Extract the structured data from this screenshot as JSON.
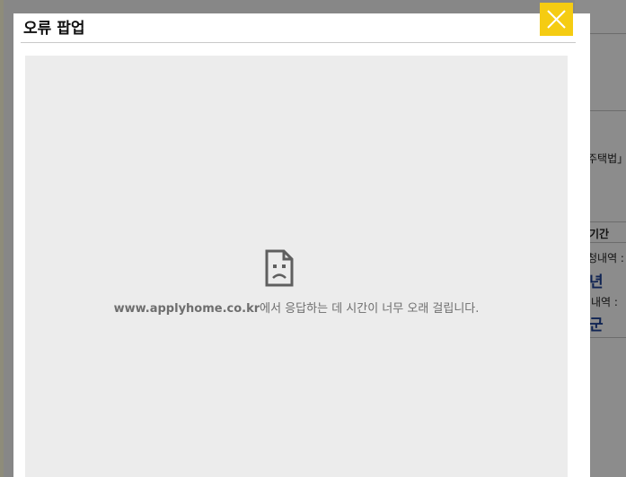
{
  "background_page": {
    "fragment_law": "주택법」",
    "fragment_period": "기간",
    "fragment_history1": "청내역 :",
    "fragment_year": "년",
    "fragment_history2": "내역 :",
    "fragment_gun": "군"
  },
  "modal": {
    "title": "오류 팝업",
    "close_icon": "close-icon",
    "accent_color": "#f5cc12"
  },
  "error_page": {
    "icon": "sad-document-icon",
    "host": "www.applyhome.co.kr",
    "message": "에서 응답하는 데 시간이 너무 오래 걸립니다."
  }
}
